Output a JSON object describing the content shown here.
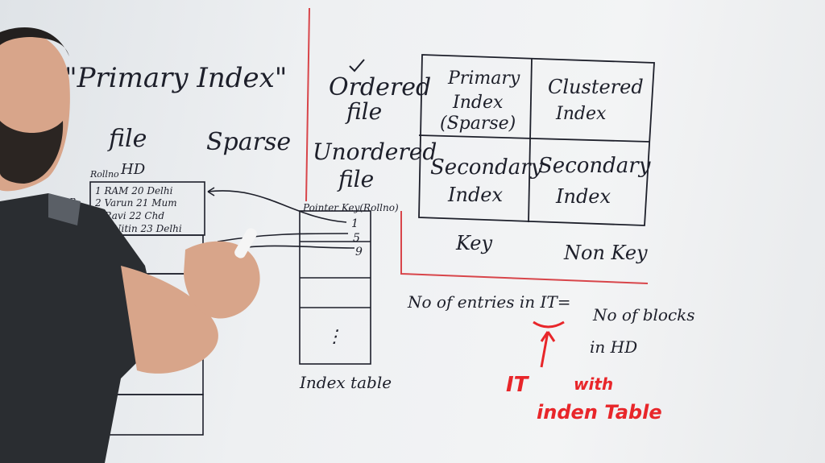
{
  "board": {
    "title": "\"Primary Index\"",
    "file_label": "file",
    "sparse_label": "Sparse",
    "hd_label": "HD",
    "rollno_label": "Rollno",
    "row_marker": "R,",
    "records": [
      "1 RAM 20 Delhi",
      "2 Varun 21 Mum",
      "3 Ravi 22 Chd",
      "Nitin 23 Delhi"
    ],
    "pointer_key_label": "Pointer Key(Rollno)",
    "index_keys": [
      "1",
      "5",
      "9"
    ],
    "index_dots": "⋮",
    "index_table_label": "Index table",
    "ordered_label": "Ordered",
    "ordered_file": "file",
    "unordered_label": "Unordered",
    "unordered_file": "file",
    "grid": {
      "primary": "Primary",
      "index": "Index",
      "sparse": "(Sparse)",
      "clustered": "Clustered",
      "clustered_index": "Index",
      "secondary": "Secondary",
      "secondary_index": "Index",
      "secondary2": "Secondary",
      "secondary2_index": "Index"
    },
    "key_label": "Key",
    "nonkey_label": "Non Key",
    "entries_text": "No of entries in IT=",
    "blocks_text": "No of blocks",
    "in_hd_text": "in HD",
    "it_label": "IT",
    "index_table_red": "inden Table",
    "scribble": "with"
  },
  "colors": {
    "marker": "#1d1f2a",
    "red_marker": "#e8262a",
    "board_line": "#d8454a",
    "shirt": "#2a2d31",
    "skin": "#d8a58a"
  }
}
